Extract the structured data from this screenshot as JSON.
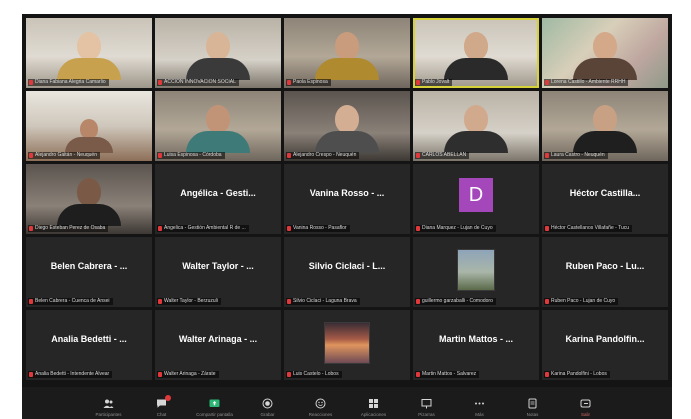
{
  "participants": [
    {
      "label": "Diana Fabiana Alegria Camarlio",
      "kind": "video"
    },
    {
      "label": "ACCION INNOVACION SOCIAL",
      "kind": "video"
    },
    {
      "label": "Paola Espinosa",
      "kind": "video"
    },
    {
      "label": "Pablo Jovalt",
      "kind": "video"
    },
    {
      "label": "Lorena Castillo - Ambiente RRHH",
      "kind": "video"
    },
    {
      "label": "Alejandro Gaitán - Neuquén",
      "kind": "video"
    },
    {
      "label": "Luisa Espinosa - Córdoba",
      "kind": "video"
    },
    {
      "label": "Alejandro Crespo - Neuquén",
      "kind": "video"
    },
    {
      "label": "CARLOS ABELLAN",
      "kind": "video"
    },
    {
      "label": "Laura Castro - Neuquén",
      "kind": "video"
    },
    {
      "label": "Diego Esteban Perez de Osaba",
      "kind": "video"
    },
    {
      "label": "Angelica - Gestión Ambiental R de ...",
      "kind": "name",
      "big": "Angélica - Gesti..."
    },
    {
      "label": "Vanina Rosso - Pasaflor",
      "kind": "name",
      "big": "Vanina Rosso - ..."
    },
    {
      "label": "Diana Marquez - Lujan de Cuyo",
      "kind": "avatar",
      "letter": "D"
    },
    {
      "label": "Héctor Castellanos Villafañe - Tucu",
      "kind": "name",
      "big": "Héctor Castilla..."
    },
    {
      "label": "Belen Cabrera - Cuenca de Ansei",
      "kind": "name",
      "big": "Belen Cabrera - ..."
    },
    {
      "label": "Walter Taylor - Berzuzuli",
      "kind": "name",
      "big": "Walter Taylor - ..."
    },
    {
      "label": "Silvio Ciclaci - Laguna Brava",
      "kind": "name",
      "big": "Silvio Ciclaci - L..."
    },
    {
      "label": "guillermo garzaballi - Comodoro",
      "kind": "image"
    },
    {
      "label": "Ruben Paco - Lujan de Cuyo",
      "kind": "name",
      "big": "Ruben Paco - Lu..."
    },
    {
      "label": "Analia Bedetti - Intendente Alvear",
      "kind": "name",
      "big": "Analia Bedetti - ..."
    },
    {
      "label": "Walter Arinaga - Zárate",
      "kind": "name",
      "big": "Walter Arinaga - ..."
    },
    {
      "label": "Luis Castelo - Lobos",
      "kind": "sunset"
    },
    {
      "label": "Martin Mattos - Salvarez",
      "kind": "name",
      "big": "Martin Mattos - ..."
    },
    {
      "label": "Karina Pandolfini - Lobos",
      "kind": "name",
      "big": "Karina Pandolfin..."
    }
  ],
  "toolbar": [
    {
      "icon": "participants-icon",
      "label": "Participantes"
    },
    {
      "icon": "chat-icon",
      "label": "Chat",
      "badge": true
    },
    {
      "icon": "share-screen-icon",
      "label": "Compartir pantalla"
    },
    {
      "icon": "record-icon",
      "label": "Grabar"
    },
    {
      "icon": "reactions-icon",
      "label": "Reacciones"
    },
    {
      "icon": "apps-icon",
      "label": "Aplicaciones"
    },
    {
      "icon": "whiteboard-icon",
      "label": "Pizarras"
    },
    {
      "icon": "more-icon",
      "label": "Más"
    },
    {
      "icon": "notes-icon",
      "label": "Notas"
    },
    {
      "icon": "leave-icon",
      "label": "Salir"
    }
  ],
  "colors": {
    "background": "#141414",
    "tile": "#262626",
    "active_border": "#d8d23a",
    "avatar": "#a347ba",
    "muted": "#e0383b"
  }
}
